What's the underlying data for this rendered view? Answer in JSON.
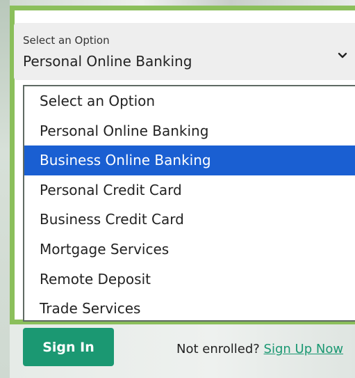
{
  "select": {
    "label": "Select an Option",
    "value": "Personal Online Banking",
    "icon": "chevron-down-icon"
  },
  "dropdown": {
    "options": [
      "Select an Option",
      "Personal Online Banking",
      "Business Online Banking",
      "Personal Credit Card",
      "Business Credit Card",
      "Mortgage Services",
      "Remote Deposit",
      "Trade Services"
    ],
    "highlighted": "Business Online Banking"
  },
  "actions": {
    "signin_label": "Sign In",
    "not_enrolled_text": "Not enrolled?",
    "signup_link": "Sign Up Now"
  },
  "colors": {
    "frame_green": "#8bbf5b",
    "highlight_blue": "#1a5fd2",
    "button_green": "#1b9872"
  }
}
